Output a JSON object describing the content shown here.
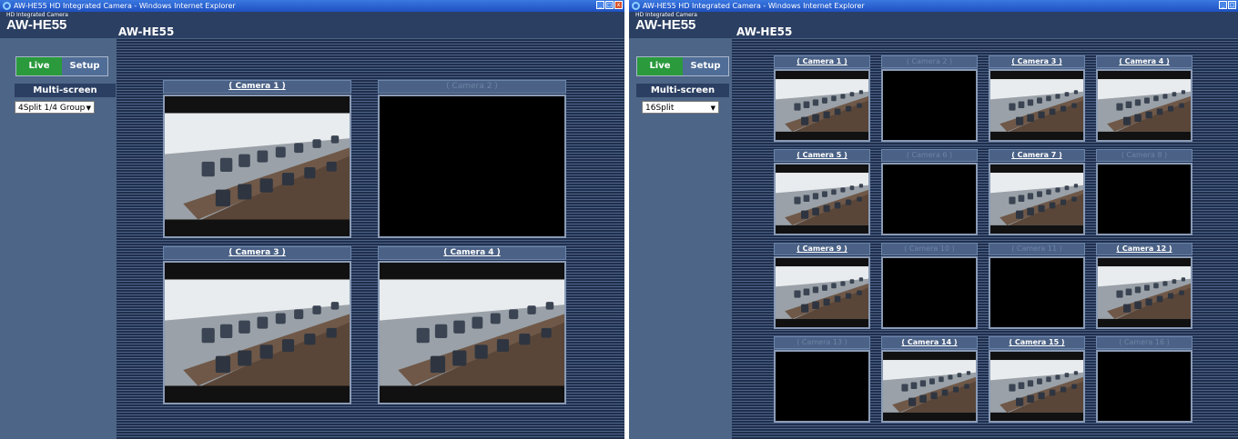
{
  "left": {
    "window_title": "AW-HE55 HD Integrated Camera - Windows Internet Explorer",
    "brand_sub": "HD Integrated Camera",
    "brand": "AW-HE55",
    "model": "AW-HE55",
    "tabs": {
      "live": "Live",
      "setup": "Setup"
    },
    "multiscreen_label": "Multi-screen",
    "select_value": "4Split 1/4 Group",
    "cameras": [
      {
        "label": "( Camera 1 )"
      },
      {
        "label": "( Camera 2 )"
      },
      {
        "label": "( Camera 3 )"
      },
      {
        "label": "( Camera 4 )"
      }
    ]
  },
  "right": {
    "window_title": "AW-HE55 HD Integrated Camera - Windows Internet Explorer",
    "brand_sub": "HD Integrated Camera",
    "brand": "AW-HE55",
    "model": "AW-HE55",
    "tabs": {
      "live": "Live",
      "setup": "Setup"
    },
    "multiscreen_label": "Multi-screen",
    "select_value": "16Split",
    "cameras": [
      {
        "label": "( Camera 1 )"
      },
      {
        "label": "( Camera 2 )"
      },
      {
        "label": "( Camera 3 )"
      },
      {
        "label": "( Camera 4 )"
      },
      {
        "label": "( Camera 5 )"
      },
      {
        "label": "( Camera 6 )"
      },
      {
        "label": "( Camera 7 )"
      },
      {
        "label": "( Camera 8 )"
      },
      {
        "label": "( Camera 9 )"
      },
      {
        "label": "( Camera 10 )"
      },
      {
        "label": "( Camera 11 )"
      },
      {
        "label": "( Camera 12 )"
      },
      {
        "label": "( Camera 13 )"
      },
      {
        "label": "( Camera 14 )"
      },
      {
        "label": "( Camera 15 )"
      },
      {
        "label": "( Camera 16 )"
      }
    ]
  },
  "colors": {
    "live_tab": "#2a9a3c",
    "setup_tab": "#4f6d97",
    "window_bg": "#2e4466"
  }
}
